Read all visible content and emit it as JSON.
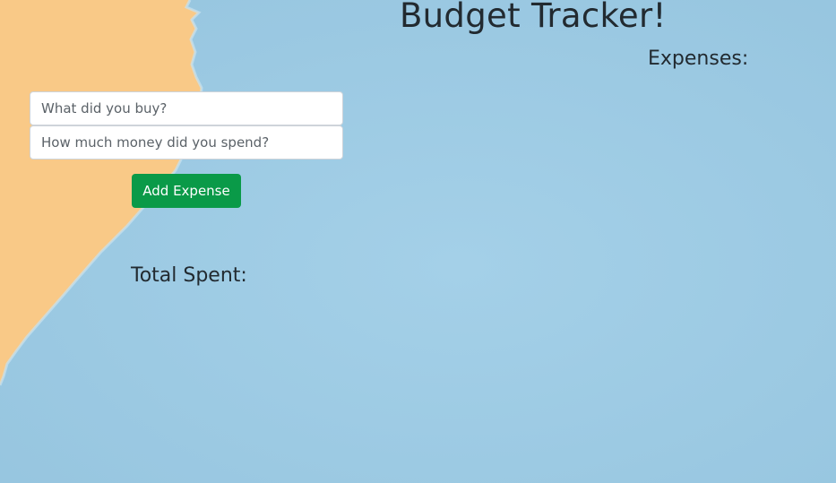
{
  "page": {
    "title": "Budget Tracker!",
    "expenses_heading": "Expenses:",
    "total_heading": "Total Spent:"
  },
  "form": {
    "item_placeholder": "What did you buy?",
    "item_value": "",
    "amount_placeholder": "How much money did you spend?",
    "amount_value": "",
    "add_button_label": "Add Expense"
  },
  "colors": {
    "background_blue": "#9ecbe3",
    "background_orange": "#f9c987",
    "button_green": "#0a9a48",
    "heading_text": "#222a30"
  }
}
